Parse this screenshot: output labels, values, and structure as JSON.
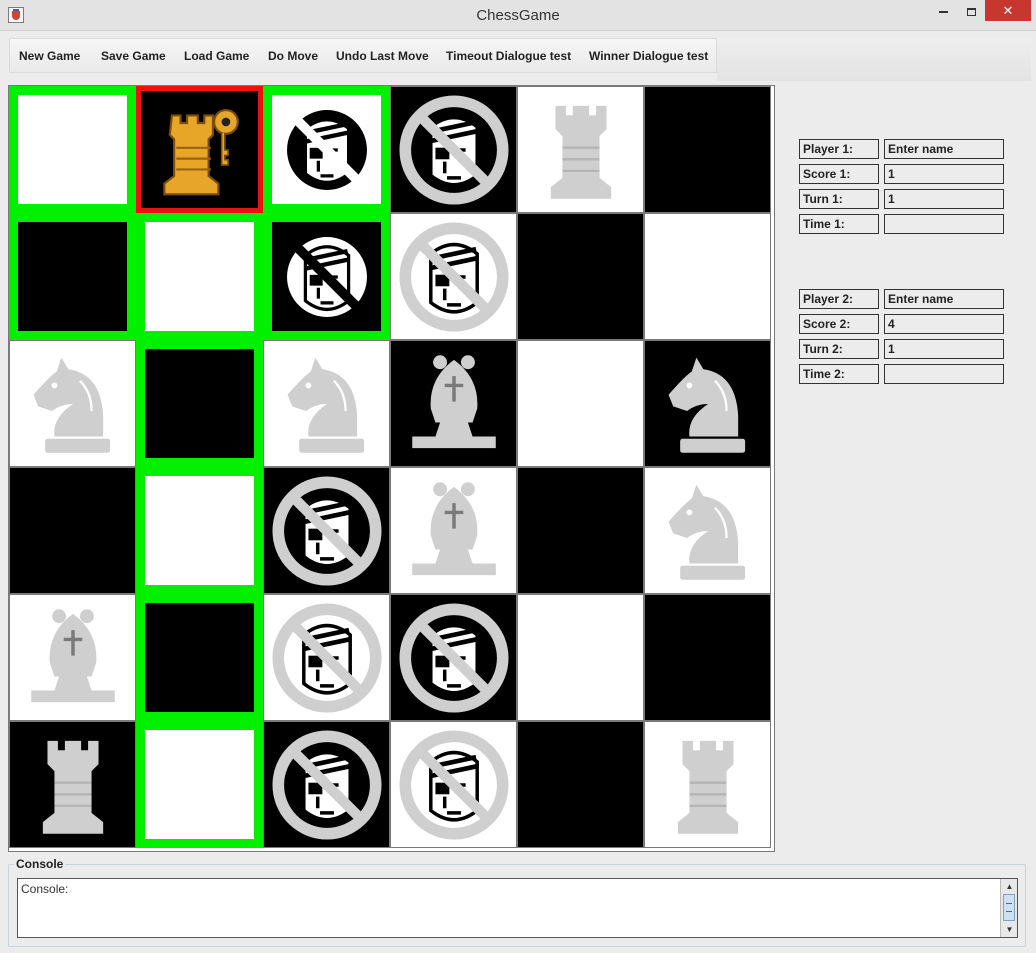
{
  "window": {
    "title": "ChessGame",
    "close_glyph": "✕"
  },
  "toolbar": {
    "buttons": [
      {
        "label": "New Game"
      },
      {
        "label": "Save Game"
      },
      {
        "label": "Load Game"
      },
      {
        "label": "Do Move"
      },
      {
        "label": "Undo Last Move"
      },
      {
        "label": "Timeout Dialogue test"
      },
      {
        "label": "Winner Dialogue test"
      }
    ]
  },
  "board": {
    "rows": 6,
    "cols": 6,
    "colors": {
      "light": "#ffffff",
      "dark": "#000000",
      "highlight_move": "#00f000",
      "highlight_selected": "#ee1111",
      "piece_gray": "#cfcfcf",
      "piece_gold": "#e8a628"
    },
    "cells": [
      {
        "row": 0,
        "col": 0,
        "color": "light",
        "piece": null,
        "highlight": "move"
      },
      {
        "row": 0,
        "col": 1,
        "color": "dark",
        "piece": "rook-key-gold",
        "highlight": "selected"
      },
      {
        "row": 0,
        "col": 2,
        "color": "light",
        "piece": "pirate-black",
        "highlight": "move"
      },
      {
        "row": 0,
        "col": 3,
        "color": "dark",
        "piece": "pirate-gray",
        "highlight": null
      },
      {
        "row": 0,
        "col": 4,
        "color": "light",
        "piece": "rook-gray",
        "highlight": null
      },
      {
        "row": 0,
        "col": 5,
        "color": "dark",
        "piece": null,
        "highlight": null
      },
      {
        "row": 1,
        "col": 0,
        "color": "dark",
        "piece": null,
        "highlight": "move"
      },
      {
        "row": 1,
        "col": 1,
        "color": "light",
        "piece": null,
        "highlight": "move"
      },
      {
        "row": 1,
        "col": 2,
        "color": "dark",
        "piece": "pirate-white",
        "highlight": "move"
      },
      {
        "row": 1,
        "col": 3,
        "color": "light",
        "piece": "pirate-gray",
        "highlight": null
      },
      {
        "row": 1,
        "col": 4,
        "color": "dark",
        "piece": null,
        "highlight": null
      },
      {
        "row": 1,
        "col": 5,
        "color": "light",
        "piece": null,
        "highlight": null
      },
      {
        "row": 2,
        "col": 0,
        "color": "light",
        "piece": "knight-gray",
        "highlight": null
      },
      {
        "row": 2,
        "col": 1,
        "color": "dark",
        "piece": null,
        "highlight": "move"
      },
      {
        "row": 2,
        "col": 2,
        "color": "light",
        "piece": "knight-gray",
        "highlight": null
      },
      {
        "row": 2,
        "col": 3,
        "color": "dark",
        "piece": "bishop-gray",
        "highlight": null
      },
      {
        "row": 2,
        "col": 4,
        "color": "light",
        "piece": null,
        "highlight": null
      },
      {
        "row": 2,
        "col": 5,
        "color": "dark",
        "piece": "knight-gray",
        "highlight": null
      },
      {
        "row": 3,
        "col": 0,
        "color": "dark",
        "piece": null,
        "highlight": null
      },
      {
        "row": 3,
        "col": 1,
        "color": "light",
        "piece": null,
        "highlight": "move"
      },
      {
        "row": 3,
        "col": 2,
        "color": "dark",
        "piece": "pirate-gray",
        "highlight": null
      },
      {
        "row": 3,
        "col": 3,
        "color": "light",
        "piece": "bishop-gray",
        "highlight": null
      },
      {
        "row": 3,
        "col": 4,
        "color": "dark",
        "piece": null,
        "highlight": null
      },
      {
        "row": 3,
        "col": 5,
        "color": "light",
        "piece": "knight-gray",
        "highlight": null
      },
      {
        "row": 4,
        "col": 0,
        "color": "light",
        "piece": "bishop-gray",
        "highlight": null
      },
      {
        "row": 4,
        "col": 1,
        "color": "dark",
        "piece": null,
        "highlight": "move"
      },
      {
        "row": 4,
        "col": 2,
        "color": "light",
        "piece": "pirate-gray",
        "highlight": null
      },
      {
        "row": 4,
        "col": 3,
        "color": "dark",
        "piece": "pirate-gray",
        "highlight": null
      },
      {
        "row": 4,
        "col": 4,
        "color": "light",
        "piece": null,
        "highlight": null
      },
      {
        "row": 4,
        "col": 5,
        "color": "dark",
        "piece": null,
        "highlight": null
      },
      {
        "row": 5,
        "col": 0,
        "color": "dark",
        "piece": "rook-gray",
        "highlight": null
      },
      {
        "row": 5,
        "col": 1,
        "color": "light",
        "piece": null,
        "highlight": "move"
      },
      {
        "row": 5,
        "col": 2,
        "color": "dark",
        "piece": "pirate-gray",
        "highlight": null
      },
      {
        "row": 5,
        "col": 3,
        "color": "light",
        "piece": "pirate-gray",
        "highlight": null
      },
      {
        "row": 5,
        "col": 4,
        "color": "dark",
        "piece": null,
        "highlight": null
      },
      {
        "row": 5,
        "col": 5,
        "color": "light",
        "piece": "rook-gray",
        "highlight": null
      }
    ]
  },
  "players": {
    "p1": {
      "player_label": "Player 1:",
      "player_value": "Enter name",
      "score_label": "Score 1:",
      "score_value": "1",
      "turn_label": "Turn 1:",
      "turn_value": "1",
      "time_label": "Time 1:",
      "time_value": ""
    },
    "p2": {
      "player_label": "Player 2:",
      "player_value": "Enter name",
      "score_label": "Score 2:",
      "score_value": "4",
      "turn_label": "Turn 2:",
      "turn_value": "1",
      "time_label": "Time 2:",
      "time_value": ""
    }
  },
  "console": {
    "legend": "Console",
    "text": "Console:"
  }
}
